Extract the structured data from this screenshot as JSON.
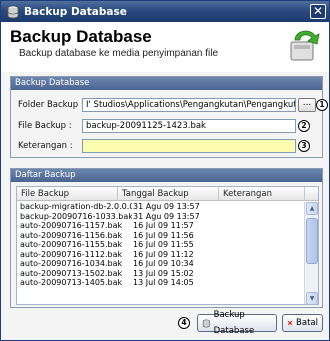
{
  "window": {
    "title": "Backup Database",
    "close_glyph": "✕"
  },
  "header": {
    "title": "Backup Database",
    "subtitle": "Backup database ke media penyimpanan file"
  },
  "form_panel": {
    "heading": "Backup Database",
    "folder_label": "Folder Backup :",
    "folder_value": "I' Studios\\Applications\\Pengangkutan\\Pengangkutan\\backups",
    "browse_label": "...",
    "file_label": "File Backup :",
    "file_value": "backup-20091125-1423.bak",
    "note_label": "Keterangan :",
    "note_value": "",
    "badges": [
      "1",
      "2",
      "3"
    ]
  },
  "list_panel": {
    "heading": "Daftar Backup",
    "columns": [
      "File Backup",
      "Tanggal Backup",
      "Keterangan"
    ],
    "rows": [
      {
        "file": "backup-migration-db-2.0.0.0.bak",
        "date": "31 Agu 09 13:57",
        "note": ""
      },
      {
        "file": "backup-20090716-1033.bak",
        "date": "31 Agu 09 13:57",
        "note": ""
      },
      {
        "file": "auto-20090716-1157.bak",
        "date": "16 Jul 09 11:57",
        "note": ""
      },
      {
        "file": "auto-20090716-1156.bak",
        "date": "16 Jul 09 11:56",
        "note": ""
      },
      {
        "file": "auto-20090716-1155.bak",
        "date": "16 Jul 09 11:55",
        "note": ""
      },
      {
        "file": "auto-20090716-1112.bak",
        "date": "16 Jul 09 11:12",
        "note": ""
      },
      {
        "file": "auto-20090716-1034.bak",
        "date": "16 Jul 09 10:34",
        "note": ""
      },
      {
        "file": "auto-20090713-1502.bak",
        "date": "13 Jul 09 15:02",
        "note": ""
      },
      {
        "file": "auto-20090713-1405.bak",
        "date": "13 Jul 09 14:05",
        "note": ""
      }
    ]
  },
  "footer": {
    "badge": "4",
    "backup_label": "Backup Database",
    "cancel_label": "Batal"
  },
  "colors": {
    "title_bar": "#2a4b7f",
    "panel_header": "#5670a0",
    "note_field": "#fdfdb0",
    "cancel_x": "#d02020"
  }
}
